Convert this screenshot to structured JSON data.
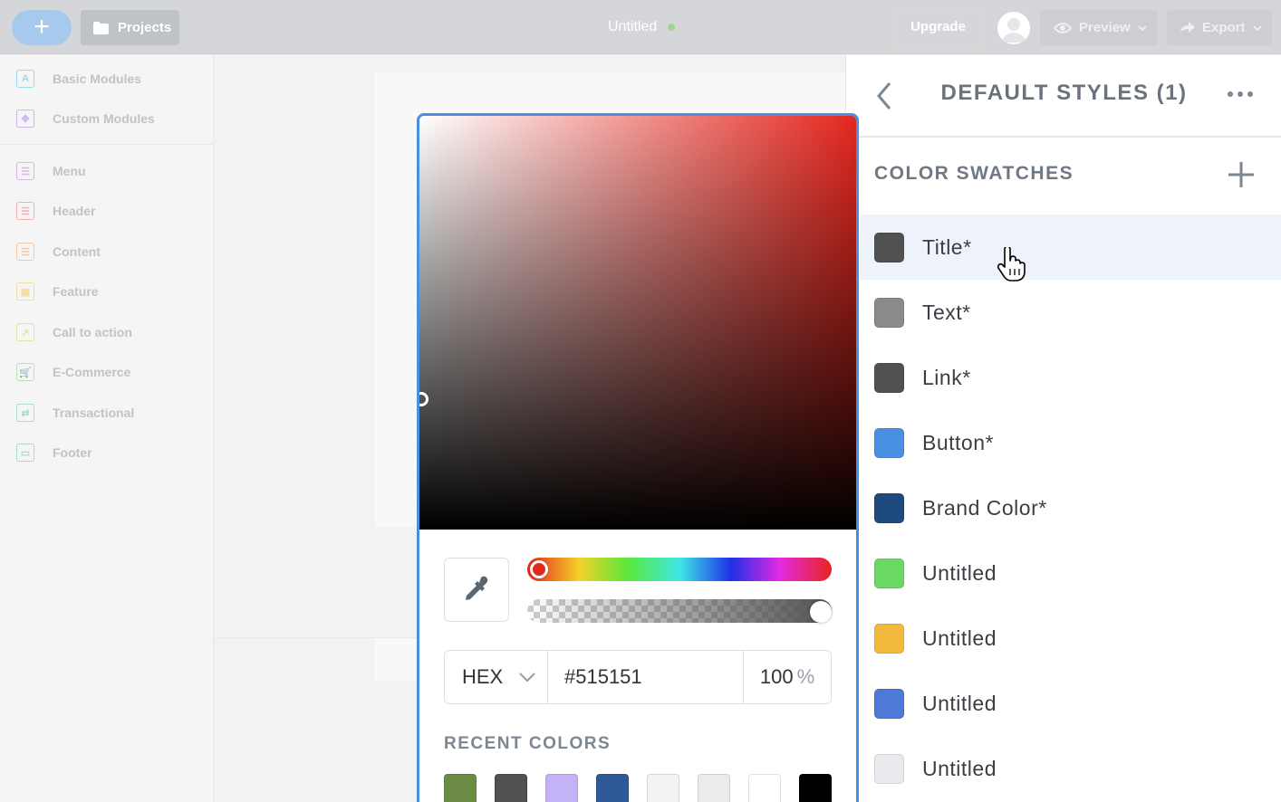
{
  "topbar": {
    "add_label": "+",
    "projects_label": "Projects",
    "doc_title": "Untitled",
    "upgrade_label": "Upgrade",
    "preview_label": "Preview",
    "export_label": "Export"
  },
  "sidebar": {
    "items": [
      {
        "label": "Basic Modules",
        "color": "#9fd8ef",
        "glyph": "A"
      },
      {
        "label": "Custom Modules",
        "color": "#c9b8ee",
        "glyph": "✥"
      },
      {
        "label": "Menu",
        "color": "#d9b6e6",
        "glyph": "☰"
      },
      {
        "label": "Header",
        "color": "#f2b1b1",
        "glyph": "☰"
      },
      {
        "label": "Content",
        "color": "#f6c8a6",
        "glyph": "☰"
      },
      {
        "label": "Feature",
        "color": "#f4dc9e",
        "glyph": "▦"
      },
      {
        "label": "Call to action",
        "color": "#d6e9a2",
        "glyph": "➚"
      },
      {
        "label": "E-Commerce",
        "color": "#b9e5b5",
        "glyph": "🛒"
      },
      {
        "label": "Transactional",
        "color": "#a7dfc7",
        "glyph": "⇄"
      },
      {
        "label": "Footer",
        "color": "#a7dcc3",
        "glyph": "▭"
      }
    ]
  },
  "picker": {
    "hue_color": "#e4281f",
    "mode": "HEX",
    "hex_value": "#515151",
    "alpha_value": "100",
    "alpha_unit": "%",
    "recent_label": "RECENT COLORS",
    "recent_colors": [
      "#6b8b45",
      "#515151",
      "#c4b2f8",
      "#2f5a9a",
      "#f3f3f3",
      "#ececec",
      "#ffffff",
      "#000000"
    ]
  },
  "panel": {
    "title": "DEFAULT STYLES (1)",
    "section_title": "COLOR SWATCHES",
    "swatches": [
      {
        "name": "Title*",
        "color": "#515151"
      },
      {
        "name": "Text*",
        "color": "#8a8a8a"
      },
      {
        "name": "Link*",
        "color": "#515151"
      },
      {
        "name": "Button*",
        "color": "#4a90e2"
      },
      {
        "name": "Brand Color*",
        "color": "#1f4a80"
      },
      {
        "name": "Untitled",
        "color": "#6cd864"
      },
      {
        "name": "Untitled",
        "color": "#f3b93c"
      },
      {
        "name": "Untitled",
        "color": "#4f79d6"
      },
      {
        "name": "Untitled",
        "color": "#e8eaed"
      }
    ]
  }
}
